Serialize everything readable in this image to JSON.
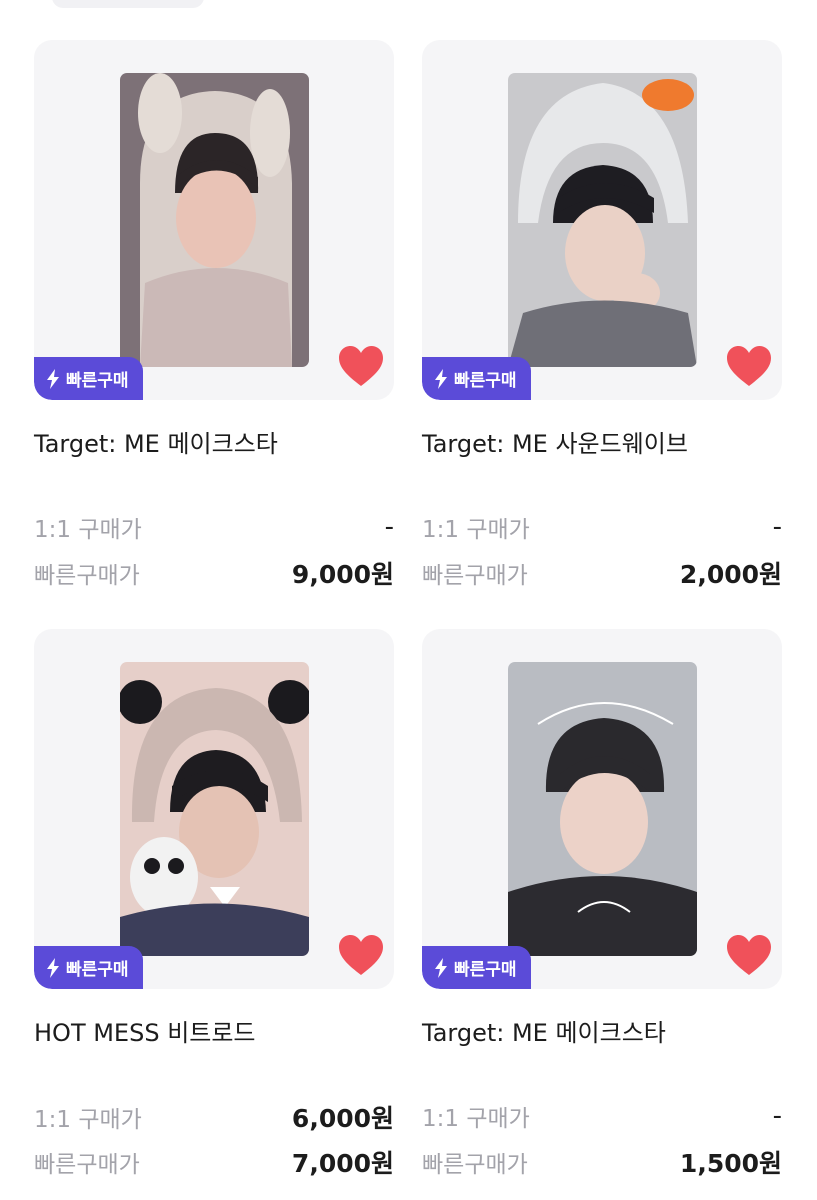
{
  "badge_label": "빠른구매",
  "labels": {
    "one_to_one": "1:1 구매가",
    "quick_price": "빠른구매가"
  },
  "colors": {
    "badge": "#5b4bd8",
    "heart": "#f0515a",
    "card_bg": "#f5f5f7",
    "muted_text": "#a3a3aa"
  },
  "icons": {
    "badge": "lightning-bolt-icon",
    "favorite": "heart-icon"
  },
  "products": [
    {
      "title": "Target: ME 메이크스타",
      "one_to_one_price": "-",
      "quick_price": "9,000원",
      "favorited": true
    },
    {
      "title": "Target: ME 사운드웨이브",
      "one_to_one_price": "-",
      "quick_price": "2,000원",
      "favorited": true
    },
    {
      "title": "HOT MESS 비트로드",
      "one_to_one_price": "6,000원",
      "quick_price": "7,000원",
      "favorited": true
    },
    {
      "title": "Target: ME 메이크스타",
      "one_to_one_price": "-",
      "quick_price": "1,500원",
      "favorited": true
    }
  ]
}
